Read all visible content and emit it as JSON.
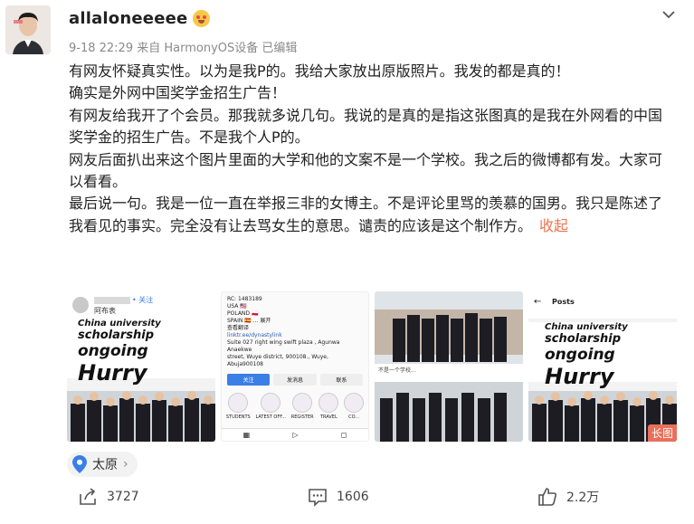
{
  "post": {
    "username": "allaloneeeee",
    "meta": "9-18 22:29 来自 HarmonyOS设备 已编辑",
    "paragraphs": [
      "有网友怀疑真实性。以为是我P的。我给大家放出原版照片。我发的都是真的！",
      "确实是外网中国奖学金招生广告！",
      "有网友给我开了个会员。那我就多说几句。我说的是真的是指这张图真的是我在外网看的中国奖学金的招生广告。不是我个人P的。",
      "网友后面扒出来这个图片里面的大学和他的文案不是一个学校。我之后的微博都有发。大家可以看看。",
      "最后说一句。我是一位一直在举报三非的女博主。不是评论里骂的羡慕的国男。我只是陈述了我看见的事实。完全没有让去骂女生的意思。谴责的应该是这个制作方。"
    ],
    "collapse_label": "收起"
  },
  "thumbnails": {
    "t1": {
      "header_name": "阿布表",
      "follow": "• 关注",
      "line1": "China university",
      "line2": "scholarship",
      "line3": "ongoing",
      "line4": "Hurry"
    },
    "t2": {
      "rc": "RC: 1483189",
      "usa": "USA 🇺🇸",
      "poland": "POLAND 🇵🇱",
      "spain": "SPAIN 🇪🇸 ... 展开",
      "more": "查看翻译",
      "link": "linktr.ee/dynastylink",
      "addr1": "Suite 027 right wing swift plaza , Agunwa Anaekwe",
      "addr2": "street, Wuye district, 900108., Wuye, Abuja900108",
      "btn_follow": "关注",
      "btn_msg": "发消息",
      "btn_contact": "联系",
      "icons": [
        "STUDENTS",
        "LATEST OFF...",
        "REGISTER",
        "TRAVEL",
        "CO..."
      ]
    },
    "t3": {
      "caption": "不是一个学校…"
    },
    "t4": {
      "back": "←",
      "posts": "Posts",
      "line1": "China university",
      "line2": "scholarship",
      "line3": "ongoing",
      "line4": "Hurry",
      "badge": "长图"
    }
  },
  "location": {
    "label": "太原",
    "chevron": "›"
  },
  "actions": {
    "share_count": "3727",
    "comment_count": "1606",
    "like_count": "2.2万"
  },
  "colors": {
    "accent": "#eb7350",
    "location_pin": "#3a7fe6",
    "badge": "#ea6f5a"
  }
}
